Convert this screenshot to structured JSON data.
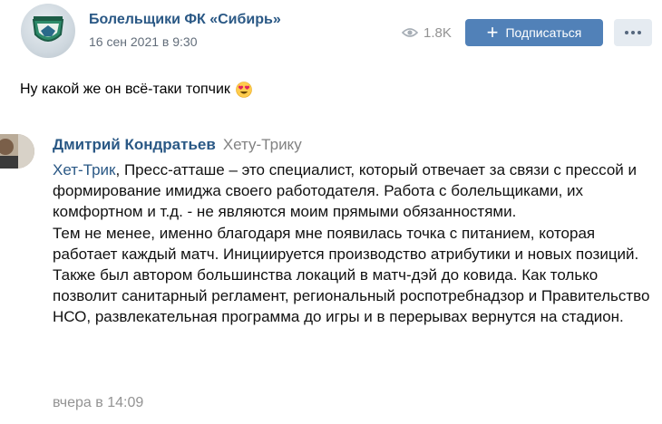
{
  "post": {
    "group_name": "Болельщики ФК «Сибирь»",
    "date": "16 сен 2021 в 9:30",
    "views": "1.8K",
    "subscribe_label": "Подписаться",
    "text": "Ну какой же он всё-таки топчик",
    "emoji_icon": "heart-eyes-emoji"
  },
  "comment": {
    "author": "Дмитрий Кондратьев",
    "reply_to": "Хету-Трику",
    "mention": "Хет-Трик",
    "paragraphs": [
      ", Пресс-атташе – это специалист, который отвечает за связи с прессой и формирование имиджа своего работодателя. Работа с болельщиками, их комфортном и т.д. - не являются моим прямыми обязанностями.",
      "Тем не менее, именно благодаря мне появилась точка с питанием, которая работает каждый матч. Инициируется производство атрибутики и новых позиций.",
      "Также был автором большинства локаций в матч-дэй до ковида. Как только позволит санитарный регламент, региональный роспотребнадзор и Правительство НСО, развлекательная программа до игры и в перерывах вернутся на стадион."
    ],
    "time": "вчера в 14:09"
  },
  "colors": {
    "link": "#2a5885",
    "button": "#5181b8",
    "muted": "#939393"
  }
}
